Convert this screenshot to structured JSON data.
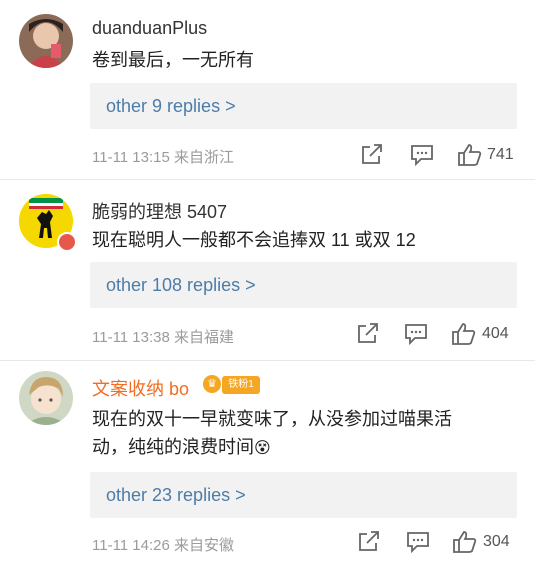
{
  "comments": [
    {
      "username": "duanduanPlus",
      "text": "卷到最后，一无所有",
      "replies": "other 9 replies >",
      "time": "11-11 13:15",
      "location": "来自浙江",
      "likes": "741"
    },
    {
      "username": "脆弱的理想 5407",
      "text": "现在聪明人一般都不会追捧双 11 或双 12",
      "replies": "other 108 replies >",
      "time": "11-11 13:38",
      "location": "来自福建",
      "likes": "404"
    },
    {
      "username": "文案收纳 bo",
      "badge": "铁粉1",
      "text_line1": "现在的双十一早就变味了，从没参加过喵果活",
      "text_line2": "动，纯纯的浪费时间",
      "emoji": "😵",
      "replies": "other 23 replies >",
      "time": "11-11 14:26",
      "location": "来自安徽",
      "likes": "304"
    }
  ],
  "icons": [
    "share-icon",
    "comment-icon",
    "like-icon"
  ],
  "colors": {
    "link": "#4d7ca8",
    "meta": "#9b9b9b",
    "fan_name": "#f26d22"
  }
}
